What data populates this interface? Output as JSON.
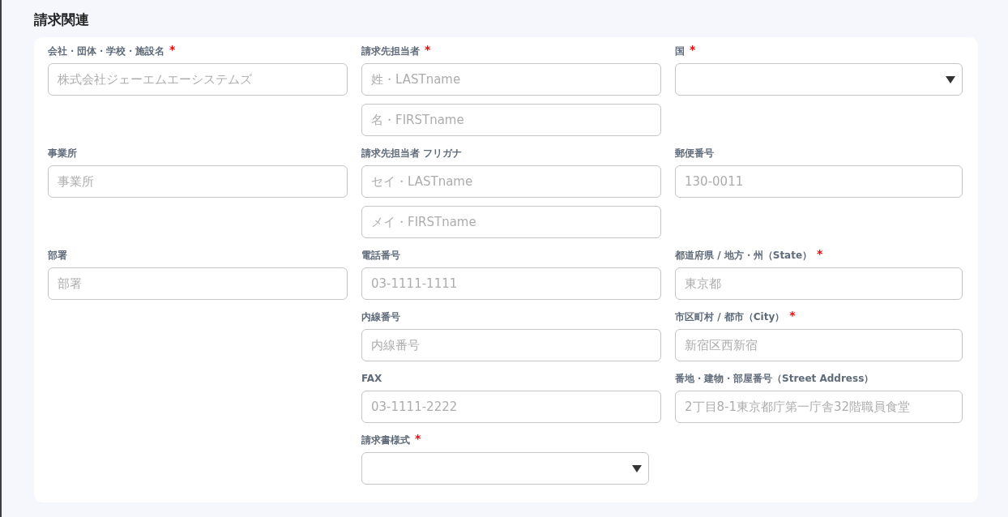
{
  "section_title": "請求関連",
  "columns": [
    {
      "fields": [
        {
          "label": "会社・団体・学校・施設名",
          "required_mark": "*",
          "kind": "text",
          "placeholders": [
            "株式会社ジェーエムエーシステムズ"
          ]
        },
        {
          "label": "事業所",
          "kind": "text",
          "placeholders": [
            "事業所"
          ]
        },
        {
          "label": "部署",
          "kind": "text",
          "placeholders": [
            "部署"
          ]
        }
      ]
    },
    {
      "fields": [
        {
          "label": "請求先担当者",
          "required_mark": "*",
          "kind": "text",
          "placeholders": [
            "姓・LASTname",
            "名・FIRSTname"
          ]
        },
        {
          "label": "請求先担当者 フリガナ",
          "kind": "text",
          "placeholders": [
            "セイ・LASTname",
            "メイ・FIRSTname"
          ]
        },
        {
          "label": "電話番号",
          "kind": "text",
          "placeholders": [
            "03-1111-1111"
          ]
        },
        {
          "label": "内線番号",
          "kind": "text",
          "placeholders": [
            "内線番号"
          ]
        },
        {
          "label": "FAX",
          "kind": "text",
          "placeholders": [
            "03-1111-2222"
          ]
        },
        {
          "label": "請求書様式",
          "required_mark": "*",
          "kind": "select"
        }
      ]
    },
    {
      "fields": [
        {
          "label": "国",
          "required_mark": "*",
          "kind": "select"
        },
        {
          "label": "郵便番号",
          "kind": "text",
          "placeholders": [
            "130-0011"
          ]
        },
        {
          "label": "都道府県 / 地方・州（State）",
          "required_mark": "*",
          "kind": "text",
          "placeholders": [
            "東京都"
          ]
        },
        {
          "label": "市区町村 / 都市（City）",
          "required_mark": "*",
          "kind": "text",
          "placeholders": [
            "新宿区西新宿"
          ]
        },
        {
          "label": "番地・建物・部屋番号（Street Address）",
          "kind": "text",
          "placeholders": [
            "2丁目8-1東京都庁第一庁舎32階職員食堂"
          ]
        }
      ]
    }
  ]
}
